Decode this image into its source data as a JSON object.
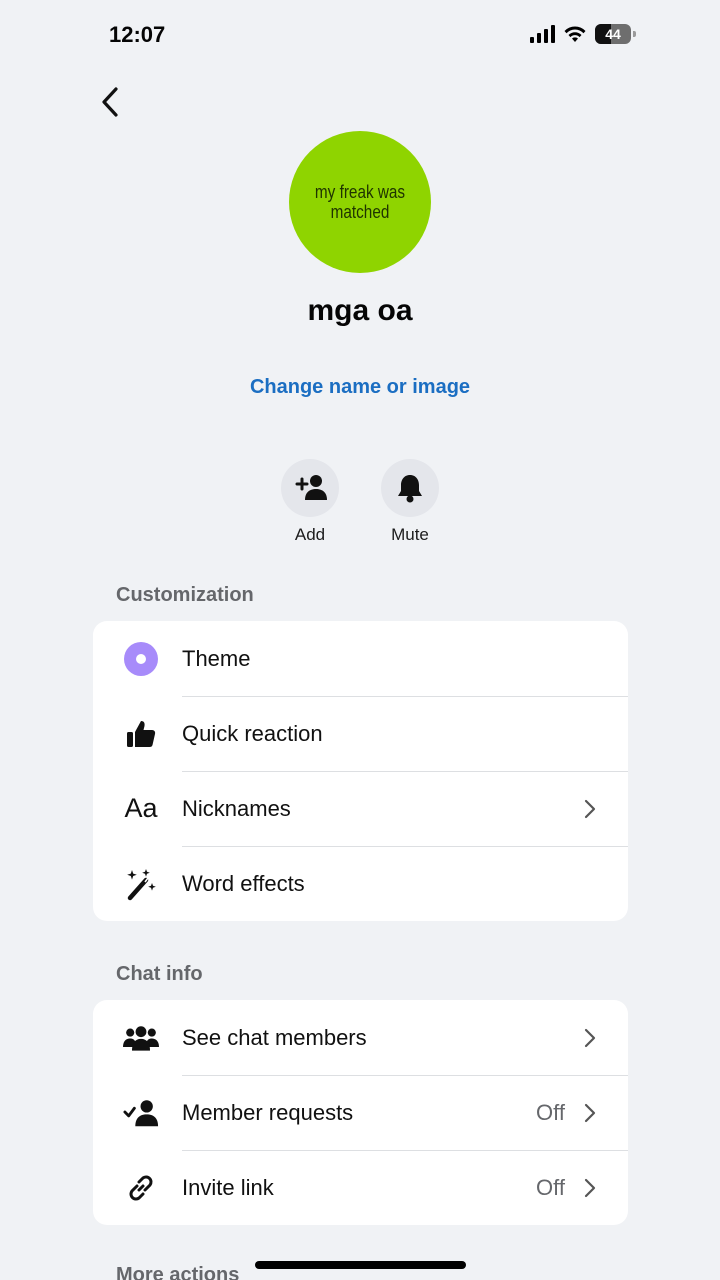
{
  "status": {
    "time": "12:07",
    "battery": "44",
    "battery_fraction": 0.44
  },
  "nav": {
    "back_icon": "chevron-left-icon"
  },
  "profile": {
    "avatar_text": "my freak was matched",
    "avatar_color": "#8fd400",
    "name": "mga oa",
    "change_link": "Change name or image"
  },
  "actions": [
    {
      "label": "Add",
      "icon": "add-person-icon"
    },
    {
      "label": "Mute",
      "icon": "bell-icon"
    }
  ],
  "customization": {
    "title": "Customization",
    "items": [
      {
        "label": "Theme",
        "icon": "theme-icon",
        "accent": "#a78bfa"
      },
      {
        "label": "Quick reaction",
        "icon": "thumbs-up-icon"
      },
      {
        "label": "Nicknames",
        "icon": "nicknames-icon",
        "icon_text": "Aa",
        "chevron": true
      },
      {
        "label": "Word effects",
        "icon": "magic-wand-icon"
      }
    ]
  },
  "chat_info": {
    "title": "Chat info",
    "items": [
      {
        "label": "See chat members",
        "icon": "people-icon",
        "chevron": true
      },
      {
        "label": "Member requests",
        "icon": "member-check-icon",
        "value": "Off",
        "chevron": true
      },
      {
        "label": "Invite link",
        "icon": "link-icon",
        "value": "Off",
        "chevron": true
      }
    ]
  },
  "more_actions": {
    "title": "More actions"
  },
  "colors": {
    "link": "#1b6ec2",
    "background": "#f0f2f5",
    "secondary_text": "#65676b"
  }
}
